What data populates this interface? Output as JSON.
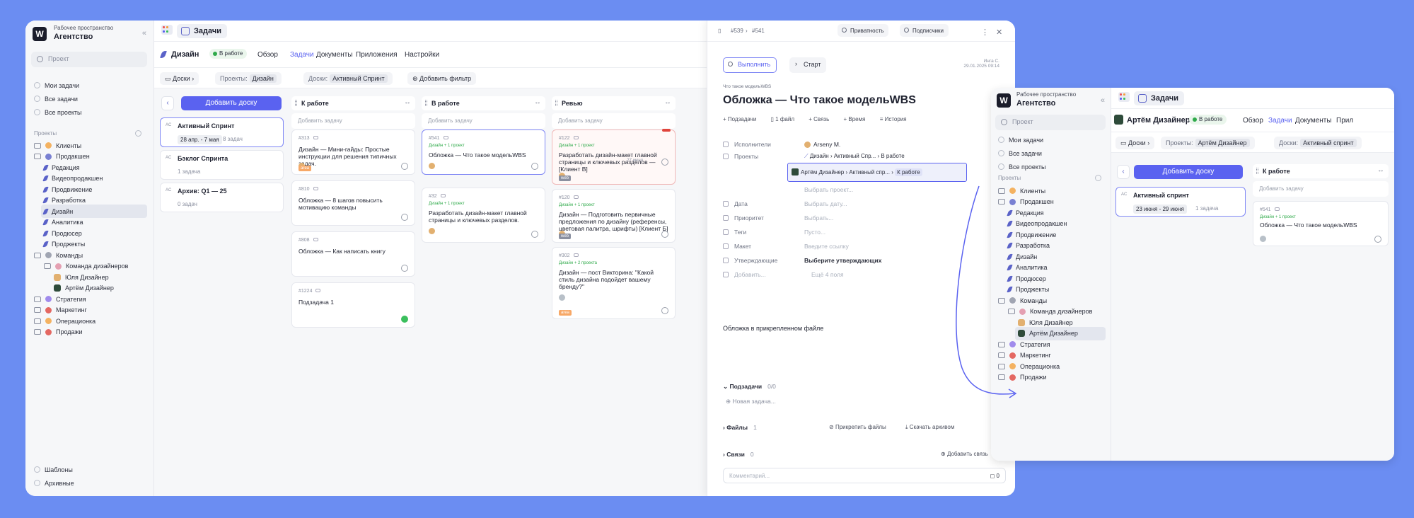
{
  "workspace": {
    "label": "Рабочее пространство",
    "name": "Агентство"
  },
  "sidebar": {
    "search_placeholder": "Проект",
    "quick": [
      "Мои задачи",
      "Все задачи",
      "Все проекты"
    ],
    "section": "Проекты",
    "tree": [
      {
        "label": "Клиенты",
        "kind": "folder"
      },
      {
        "label": "Продакшен",
        "kind": "folder"
      },
      {
        "label": "Редакция",
        "kind": "project"
      },
      {
        "label": "Видеопродакшен",
        "kind": "project"
      },
      {
        "label": "Продвижение",
        "kind": "project"
      },
      {
        "label": "Разработка",
        "kind": "project"
      },
      {
        "label": "Дизайн",
        "kind": "project"
      },
      {
        "label": "Аналитика",
        "kind": "project"
      },
      {
        "label": "Продюсер",
        "kind": "project"
      },
      {
        "label": "Проджекты",
        "kind": "project"
      },
      {
        "label": "Команды",
        "kind": "folder"
      },
      {
        "label": "Команда дизайнеров",
        "kind": "folder"
      },
      {
        "label": "Юля Дизайнер",
        "kind": "person"
      },
      {
        "label": "Артём Дизайнер",
        "kind": "person"
      },
      {
        "label": "Стратегия",
        "kind": "folder"
      },
      {
        "label": "Маркетинг",
        "kind": "folder"
      },
      {
        "label": "Операционка",
        "kind": "folder"
      },
      {
        "label": "Продажи",
        "kind": "folder"
      }
    ],
    "bottom": [
      "Шаблоны",
      "Архивные"
    ]
  },
  "topbar": {
    "tab": "Задачи"
  },
  "header": {
    "project": "Дизайн",
    "status": "В работе",
    "nav": [
      "Обзор",
      "Задачи",
      "Документы",
      "Приложения",
      "Настройки"
    ]
  },
  "filters": {
    "boards": "Доски",
    "projects_label": "Проекты:",
    "projects_value": "Дизайн",
    "boards_label": "Доски:",
    "boards_value": "Активный Спринт",
    "add_filter": "Добавить фильтр"
  },
  "boards": {
    "add_label": "Добавить доску",
    "items": [
      {
        "title": "Активный Спринт",
        "dates": "28 апр. - 7 мая",
        "count": "8 задач"
      },
      {
        "title": "Бэклог Спринта",
        "dates": "",
        "count": "1 задача"
      },
      {
        "title": "Архив: Q1 — 25",
        "dates": "",
        "count": "0 задач"
      }
    ]
  },
  "columns": [
    {
      "title": "К работе",
      "add": "Добавить задачу",
      "cards": [
        {
          "id": "#313",
          "project": "",
          "title": "Дизайн — Мини-гайды: Простые инструкции для решения типичных задач.",
          "tag": "area",
          "date": ""
        },
        {
          "id": "#810",
          "project": "",
          "title": "Обложка — 8 шагов повысить мотивацию команды",
          "tag": "",
          "date": ""
        },
        {
          "id": "#808",
          "project": "",
          "title": "Обложка — Как написать книгу",
          "tag": "",
          "date": ""
        },
        {
          "id": "#1224",
          "project": "",
          "title": "Подзадача 1",
          "tag": "",
          "date": ""
        }
      ]
    },
    {
      "title": "В работе",
      "add": "Добавить задачу",
      "cards": [
        {
          "id": "#541",
          "project": "Дизайн + 1 проект",
          "title": "Обложка — Что такое модельWBS",
          "tag": "",
          "date": ""
        },
        {
          "id": "#32",
          "project": "Дизайн + 1 проект",
          "title": "Разработать дизайн-макет главной страницы и ключевых разделов.",
          "tag": "",
          "date": ""
        }
      ]
    },
    {
      "title": "Ревью",
      "add": "Добавить задачу",
      "cards": [
        {
          "id": "#122",
          "project": "Дизайн + 1 проект",
          "title": "Разработать дизайн-макет главной страницы и ключевых разделов — [Клиент В]",
          "tag": "web",
          "date": "27 июня"
        },
        {
          "id": "#120",
          "project": "Дизайн + 1 проект",
          "title": "Дизайн — Подготовить первичные предложения по дизайну (референсы, цветовая палитра, шрифты) [Клиент Б]",
          "tag": "web",
          "date": ""
        },
        {
          "id": "#302",
          "project": "Дизайн + 2 проекта",
          "title": "Дизайн — пост Викторина: \"Какой стиль дизайна подойдет вашему бренду?\"",
          "tag": "area",
          "date": ""
        }
      ]
    }
  ],
  "panel": {
    "ids": [
      "#539",
      "#541"
    ],
    "privacy": "Приватность",
    "subscribers": "Подписчики",
    "done": "Выполнить",
    "start": "Старт",
    "author": "Инга С.",
    "created": "29.01.2025 09:14",
    "crumb": "Что такое модельWBS",
    "title": "Обложка — Что такое модельWBS",
    "actions": [
      "Подзадачи",
      "1 файл",
      "Связь",
      "Время",
      "История"
    ],
    "assignee_label": "Исполнители",
    "assignee": "Arseny M.",
    "projects_label": "Проекты",
    "path1": [
      "Дизайн",
      "Активный Спр...",
      "В работе"
    ],
    "path2": [
      "Артём Дизайнер",
      "Активный спр...",
      "К работе"
    ],
    "choose_project": "Выбрать проект...",
    "date_label": "Дата",
    "date_ph": "Выбрать дату...",
    "priority_label": "Приоритет",
    "priority_ph": "Выбрать...",
    "tags_label": "Теги",
    "tags_ph": "Пусто...",
    "layout_label": "Макет",
    "layout_ph": "Введите ссылку",
    "approval_label": "Утверждающие",
    "approval_value": "Выберите утверждающих",
    "add_more": "Добавить...",
    "more_fields": "Ещё 4 поля",
    "description": "Обложка в прикрепленном файле",
    "subtasks": "Подзадачи",
    "subtasks_count": "0/0",
    "new_subtask": "Новая задача...",
    "files": "Файлы",
    "files_count": "1",
    "attach": "Прикрепить файлы",
    "download": "Скачать архивом",
    "links": "Связи",
    "links_count": "0",
    "add_link": "Добавить связь",
    "time": "Время",
    "comment_ph": "Комментарий...",
    "comment_count": "0"
  },
  "second": {
    "tab": "Задачи",
    "person": "Артём Дизайнер",
    "status": "В работе",
    "nav": [
      "Обзор",
      "Задачи",
      "Документы",
      "Прил"
    ],
    "filters": {
      "boards": "Доски",
      "projects_label": "Проекты:",
      "projects_value": "Артём Дизайнер",
      "boards_label": "Доски:",
      "boards_value": "Активный спринт"
    },
    "add_board": "Добавить доску",
    "board": {
      "title": "Активный спринт",
      "dates": "23 июня - 29 июня",
      "count": "1 задача"
    },
    "column": "К работе",
    "add_task": "Добавить задачу",
    "card": {
      "id": "#541",
      "project": "Дизайн + 1 проект",
      "title": "Обложка — Что такое модельWBS"
    }
  }
}
